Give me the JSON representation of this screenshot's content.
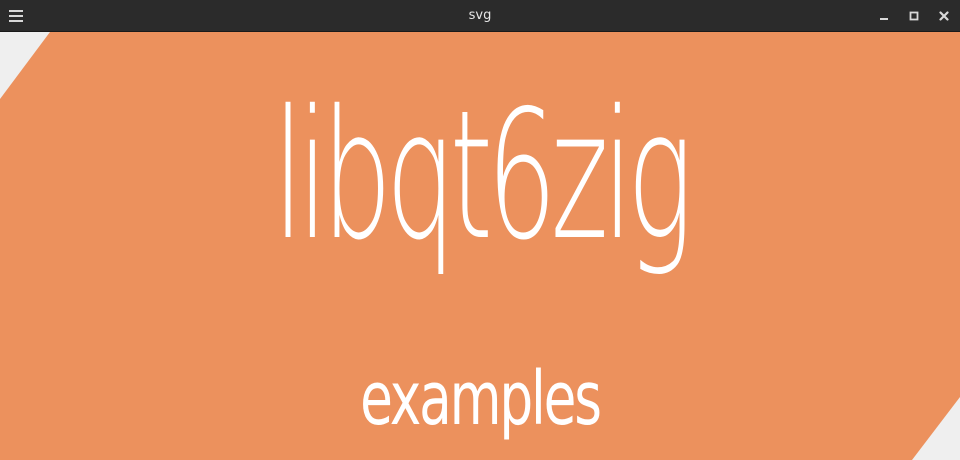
{
  "window": {
    "title": "svg"
  },
  "canvas": {
    "headline": "libqt6zig",
    "subline": "examples"
  },
  "colors": {
    "titlebar": "#2b2b2b",
    "shape_fill": "#ec915d",
    "background": "#efefef",
    "text": "#ffffff"
  },
  "icons": {
    "menu": "hamburger-menu-icon",
    "minimize": "minimize-icon",
    "maximize": "maximize-icon",
    "close": "close-icon"
  }
}
